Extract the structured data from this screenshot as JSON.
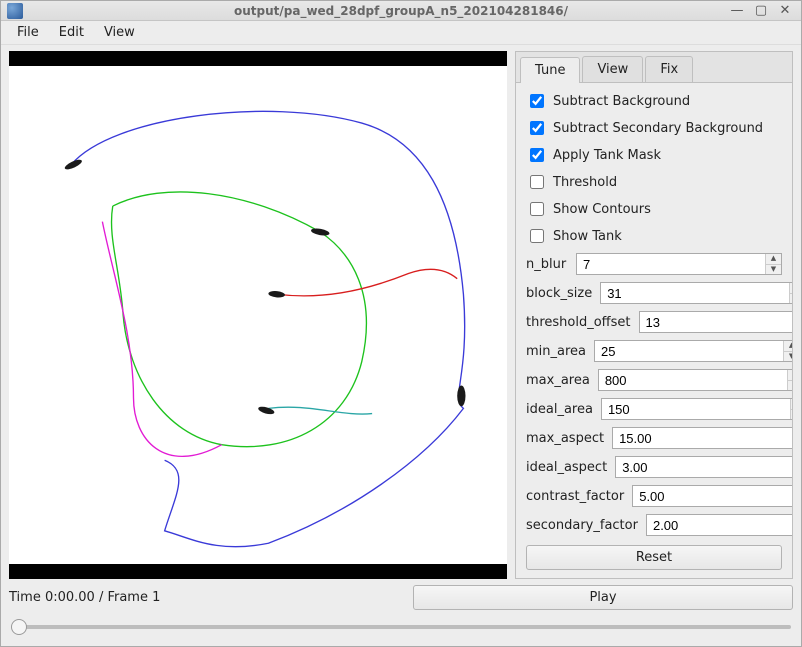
{
  "window": {
    "title": "output/pa_wed_28dpf_groupA_n5_202104281846/"
  },
  "menu": {
    "file": "File",
    "edit": "Edit",
    "view": "View"
  },
  "tabs": {
    "tune": "Tune",
    "view": "View",
    "fix": "Fix"
  },
  "checks": [
    {
      "label": "Subtract Background",
      "checked": true
    },
    {
      "label": "Subtract Secondary Background",
      "checked": true
    },
    {
      "label": "Apply Tank Mask",
      "checked": true
    },
    {
      "label": "Threshold",
      "checked": false
    },
    {
      "label": "Show Contours",
      "checked": false
    },
    {
      "label": "Show Tank",
      "checked": false
    }
  ],
  "params": [
    {
      "name": "n_blur",
      "value": "7"
    },
    {
      "name": "block_size",
      "value": "31"
    },
    {
      "name": "threshold_offset",
      "value": "13"
    },
    {
      "name": "min_area",
      "value": "25"
    },
    {
      "name": "max_area",
      "value": "800"
    },
    {
      "name": "ideal_area",
      "value": "150"
    },
    {
      "name": "max_aspect",
      "value": "15.00"
    },
    {
      "name": "ideal_aspect",
      "value": "3.00"
    },
    {
      "name": "contrast_factor",
      "value": "5.00"
    },
    {
      "name": "secondary_factor",
      "value": "2.00"
    }
  ],
  "buttons": {
    "reset": "Reset",
    "play": "Play"
  },
  "status": "Time 0:00.00 / Frame 1",
  "tracks": {
    "colors": {
      "blue": "#3a3ad8",
      "green": "#1dc21d",
      "magenta": "#e21bd4",
      "red": "#d81e1e",
      "teal": "#2aa6a6"
    }
  }
}
